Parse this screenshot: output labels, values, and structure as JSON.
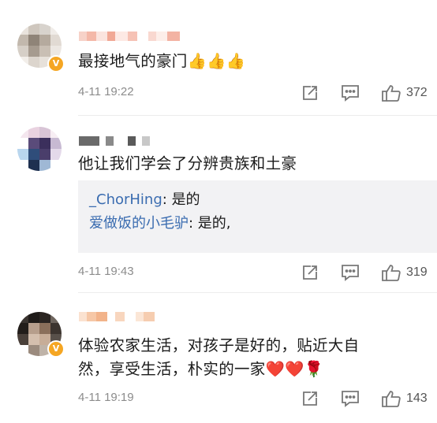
{
  "comments": [
    {
      "text": "最接地气的豪门👍👍👍",
      "time": "4-11 19:22",
      "likes": "372"
    },
    {
      "text": "他让我们学会了分辨贵族和土豪",
      "replies": [
        {
          "name": "_ChorHing",
          "sep": ": ",
          "text": "是的"
        },
        {
          "name": "爱做饭的小毛驴",
          "sep": ": ",
          "text": "是的,"
        }
      ],
      "time": "4-11 19:43",
      "likes": "319"
    },
    {
      "text_line1": "体验农家生活，对孩子是好的，贴近大自",
      "text_line2": "然，享受生活，朴实的一家❤️❤️🌹",
      "time": "4-11 19:19",
      "likes": "143"
    }
  ],
  "icons": {
    "share": "share-icon",
    "comment": "comment-icon",
    "like": "thumbs-up-icon",
    "badge": "verified-v-badge"
  },
  "colors": {
    "reply_name": "#3a6cb0",
    "meta": "#8c8c8c",
    "reply_bg": "#f2f2f4",
    "badge": "#f5a623"
  }
}
